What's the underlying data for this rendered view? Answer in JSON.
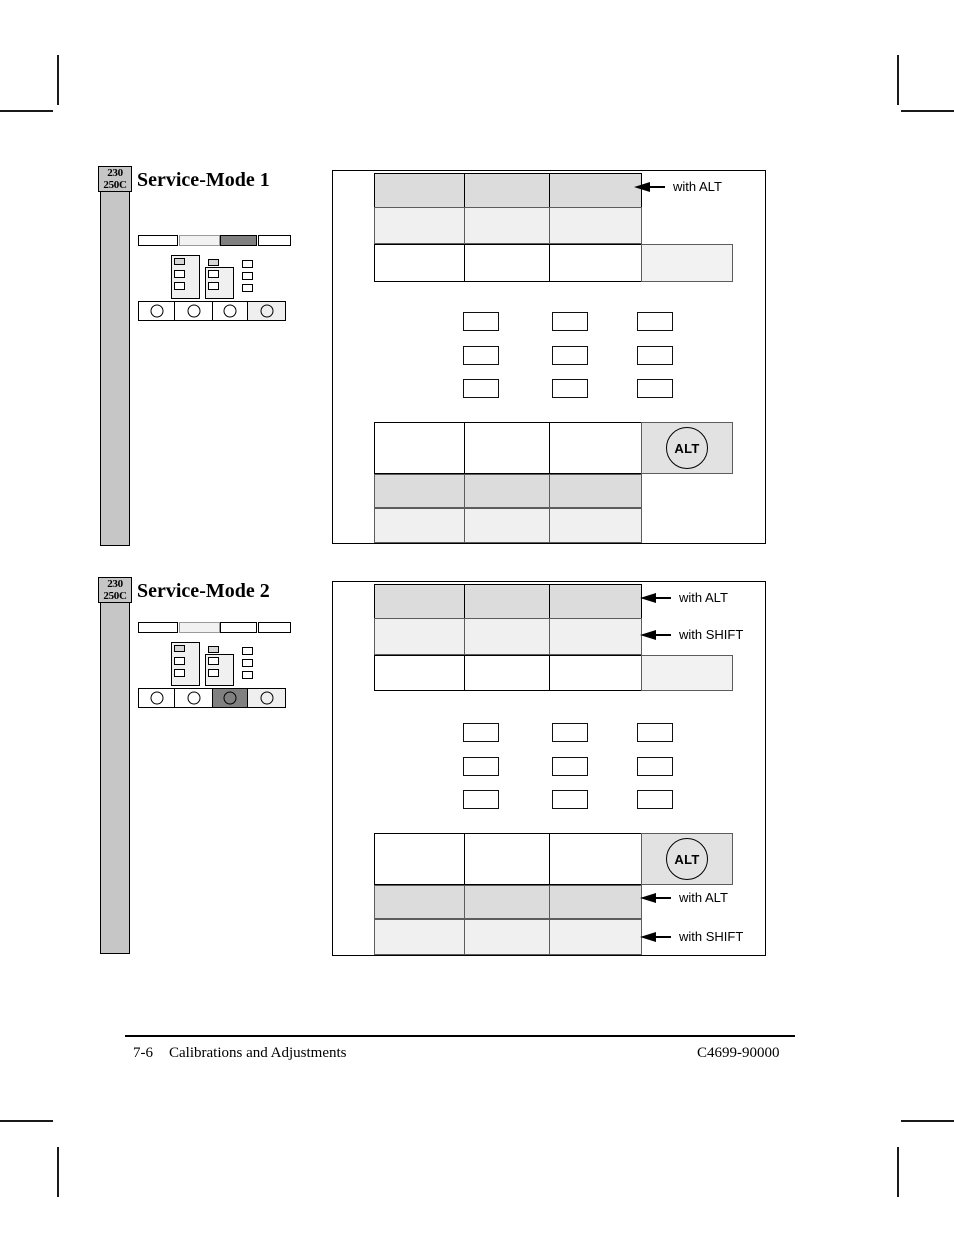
{
  "document": {
    "footer": {
      "page_number": "7-6",
      "chapter_title": "Calibrations and Adjustments",
      "part_number": "C4699-90000"
    }
  },
  "sections": [
    {
      "id": "service-mode-1",
      "title": "Service-Mode 1",
      "model_label_line1": "230",
      "model_label_line2": "250C",
      "callouts": [
        {
          "id": "sm1-top-alt",
          "text": "with ALT"
        }
      ],
      "mini_keyboard": {
        "top_keys": [
          {
            "name": "key-top-1",
            "fill": "white"
          },
          {
            "name": "key-top-2",
            "fill": "light"
          },
          {
            "name": "key-top-3",
            "fill": "dark"
          },
          {
            "name": "key-top-4",
            "fill": "white"
          }
        ],
        "bottom_buttons": [
          {
            "name": "btn-1",
            "fill": "white"
          },
          {
            "name": "btn-2",
            "fill": "white"
          },
          {
            "name": "btn-3",
            "fill": "white"
          },
          {
            "name": "btn-4",
            "fill": "light"
          }
        ]
      },
      "detail_panel": {
        "top_table": {
          "rows": [
            {
              "name": "row-alt",
              "style": "g-dark",
              "cells": 3,
              "extra_cell": null
            },
            {
              "name": "row-mid",
              "style": "g-light",
              "cells": 3,
              "extra_cell": null
            },
            {
              "name": "row-base",
              "style": "g-white",
              "cells": 3,
              "extra_cell": "g-pale"
            }
          ]
        },
        "key_grid": {
          "rows": 3,
          "cols": 3
        },
        "bottom_table": {
          "rows": [
            {
              "name": "row-base",
              "style": "g-white",
              "cells": 3,
              "extra_cell": "g-alt",
              "alt_key_label": "ALT"
            },
            {
              "name": "row-alt",
              "style": "g-dark",
              "cells": 3,
              "extra_cell": null
            },
            {
              "name": "row-shift",
              "style": "g-light",
              "cells": 3,
              "extra_cell": null
            }
          ]
        }
      }
    },
    {
      "id": "service-mode-2",
      "title": "Service-Mode 2",
      "model_label_line1": "230",
      "model_label_line2": "250C",
      "callouts": [
        {
          "id": "sm2-top-alt",
          "text": "with ALT"
        },
        {
          "id": "sm2-top-shift",
          "text": "with SHIFT"
        },
        {
          "id": "sm2-bot-alt",
          "text": "with ALT"
        },
        {
          "id": "sm2-bot-shift",
          "text": "with SHIFT"
        }
      ],
      "mini_keyboard": {
        "top_keys": [
          {
            "name": "key-top-1",
            "fill": "white"
          },
          {
            "name": "key-top-2",
            "fill": "light"
          },
          {
            "name": "key-top-3",
            "fill": "white"
          },
          {
            "name": "key-top-4",
            "fill": "white"
          }
        ],
        "bottom_buttons": [
          {
            "name": "btn-1",
            "fill": "white"
          },
          {
            "name": "btn-2",
            "fill": "white"
          },
          {
            "name": "btn-3",
            "fill": "dark"
          },
          {
            "name": "btn-4",
            "fill": "light"
          }
        ]
      },
      "detail_panel": {
        "top_table": {
          "rows": [
            {
              "name": "row-alt",
              "style": "g-dark",
              "cells": 3,
              "extra_cell": null
            },
            {
              "name": "row-shift",
              "style": "g-light",
              "cells": 3,
              "extra_cell": null
            },
            {
              "name": "row-base",
              "style": "g-white",
              "cells": 3,
              "extra_cell": "g-pale"
            }
          ]
        },
        "key_grid": {
          "rows": 3,
          "cols": 3
        },
        "bottom_table": {
          "rows": [
            {
              "name": "row-base",
              "style": "g-white",
              "cells": 3,
              "extra_cell": "g-alt",
              "alt_key_label": "ALT"
            },
            {
              "name": "row-alt",
              "style": "g-dark",
              "cells": 3,
              "extra_cell": null
            },
            {
              "name": "row-shift",
              "style": "g-light",
              "cells": 3,
              "extra_cell": null
            }
          ]
        }
      }
    }
  ],
  "alt_key_label": "ALT"
}
